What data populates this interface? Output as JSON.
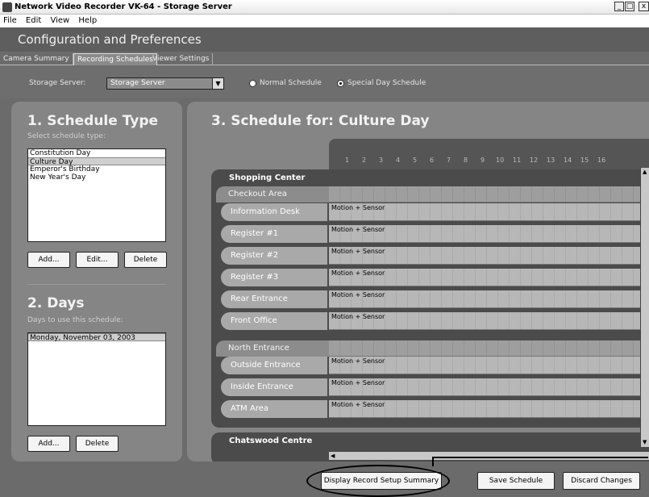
{
  "window": {
    "title": "Network Video Recorder VK-64 - Storage Server",
    "controls": [
      "_",
      "□",
      "x"
    ]
  },
  "menu": [
    "File",
    "Edit",
    "View",
    "Help"
  ],
  "app_title": "Configuration and Preferences",
  "tabs": [
    {
      "label": "Camera Summary"
    },
    {
      "label": "Recording Schedules"
    },
    {
      "label": "Viewer Settings"
    }
  ],
  "server": {
    "label": "Storage Server:",
    "value": "Storage Server",
    "normal_label": "Normal Schedule",
    "special_label": "Special Day Schedule",
    "selected": "special"
  },
  "schedule_type": {
    "title": "1. Schedule Type",
    "subtitle": "Select schedule type:",
    "items": [
      "Constitution Day",
      "Culture Day",
      "Emperor's Birthday",
      "New Year's Day"
    ],
    "selected_index": 1,
    "add": "Add...",
    "edit": "Edit...",
    "delete": "Delete"
  },
  "days": {
    "title": "2. Days",
    "subtitle": "Days to use this schedule:",
    "items": [
      "Monday, November 03, 2003"
    ],
    "add": "Add...",
    "delete": "Delete"
  },
  "schedule": {
    "title": "3. Schedule for: Culture Day",
    "hours": [
      "1",
      "2",
      "3",
      "4",
      "5",
      "6",
      "7",
      "8",
      "9",
      "10",
      "11",
      "12",
      "13",
      "14",
      "15",
      "16"
    ],
    "groups": [
      {
        "name": "Shopping Center",
        "subgroups": [
          {
            "name": "Checkout Area",
            "cameras": [
              {
                "name": "Information Desk",
                "mode": "Motion + Sensor"
              },
              {
                "name": "Register #1",
                "mode": "Motion + Sensor"
              },
              {
                "name": "Register #2",
                "mode": "Motion + Sensor"
              },
              {
                "name": "Register #3",
                "mode": "Motion + Sensor"
              },
              {
                "name": "Rear Entrance",
                "mode": "Motion + Sensor"
              },
              {
                "name": "Front Office",
                "mode": "Motion + Sensor"
              }
            ]
          },
          {
            "name": "North Entrance",
            "cameras": [
              {
                "name": "Outside Entrance",
                "mode": "Motion + Sensor"
              },
              {
                "name": "Inside Entrance",
                "mode": "Motion + Sensor"
              },
              {
                "name": "ATM Area",
                "mode": "Motion + Sensor"
              }
            ]
          }
        ]
      },
      {
        "name": "Chatswood Centre",
        "subgroups": []
      }
    ]
  },
  "buttons": {
    "summary": "Display Record Setup Summary",
    "save": "Save Schedule",
    "discard": "Discard Changes"
  },
  "colors": {
    "panel": "#858585",
    "background": "#6b6b6b",
    "cell": "#b7b7b7"
  }
}
